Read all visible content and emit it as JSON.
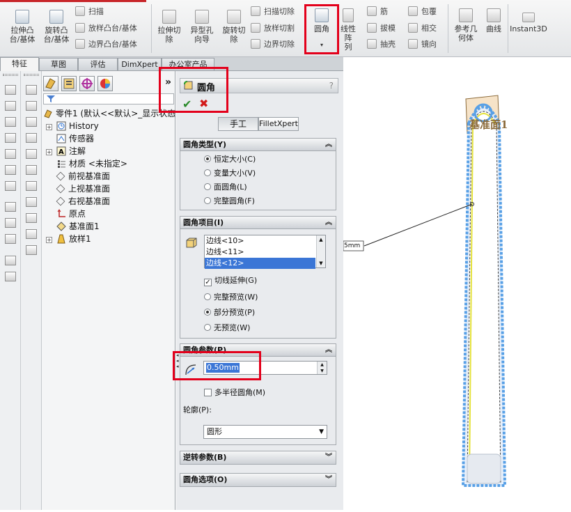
{
  "ribbon": {
    "buttons": {
      "extrude_boss": "拉伸凸\n台/基体",
      "revolve_boss": "旋转凸\n台/基体",
      "extrude_cut": "拉伸切\n除",
      "hole_wizard": "异型孔\n向导",
      "revolve_cut": "旋转切\n除",
      "fillet": "圆角",
      "linear_pattern": "线性阵\n列",
      "reference_geometry": "参考几\n何体",
      "curves": "曲线",
      "instant3d": "Instant3D"
    },
    "small": {
      "sweep": "扫描",
      "loft": "放样凸台/基体",
      "boundary": "边界凸台/基体",
      "swept_cut": "扫描切除",
      "lofted_cut": "放样切割",
      "boundary_cut": "边界切除",
      "rib": "筋",
      "draft": "拔模",
      "shell": "抽壳",
      "wrap": "包覆",
      "intersect": "相交",
      "mirror": "镜向"
    }
  },
  "tabs": [
    "特征",
    "草图",
    "评估",
    "DimXpert",
    "办公室产品"
  ],
  "tree": {
    "root": "零件1  (默认<<默认>_显示状态",
    "items": [
      "History",
      "传感器",
      "注解",
      "材质 <未指定>",
      "前视基准面",
      "上视基准面",
      "右视基准面",
      "原点",
      "基准面1",
      "放样1"
    ],
    "collapse_glyph": "»"
  },
  "pm": {
    "title": "圆角",
    "help": "?",
    "ok": "✔",
    "cancel": "✖",
    "mode_manual": "手工",
    "mode_filletxpert": "FilletXpert",
    "type_group": {
      "title": "圆角类型(Y)",
      "options": [
        "恒定大小(C)",
        "变量大小(V)",
        "面圆角(L)",
        "完整圆角(F)"
      ]
    },
    "items_group": {
      "title": "圆角项目(I)",
      "edges": [
        "边线<10>",
        "边线<11>",
        "边线<12>"
      ],
      "tangent": "切线延伸(G)",
      "preview": [
        "完整预览(W)",
        "部分预览(P)",
        "无预览(W)"
      ]
    },
    "params_group": {
      "title": "圆角参数(P)",
      "radius": "0.50mm",
      "multi_radius": "多半径圆角(M)",
      "profile_label": "轮廓(P):",
      "profile_value": "圆形"
    },
    "setback_group": {
      "title": "逆转参数(B)"
    },
    "options_group": {
      "title": "圆角选项(O)"
    }
  },
  "gfx": {
    "plane_label": "基准面1",
    "dimension": "5mm"
  },
  "colors": {
    "highlight": "#e3001b",
    "selection": "#3b76d6",
    "preview_outline": "#4a90e2"
  }
}
